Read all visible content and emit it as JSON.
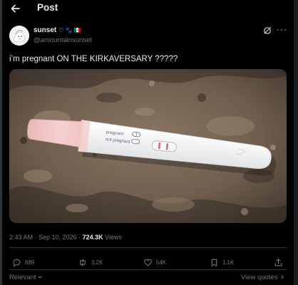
{
  "header": {
    "title": "Post",
    "back_icon": "arrow-left-icon"
  },
  "author": {
    "display_name": "sunset",
    "name_emojis": "♡ 🐾 🇲🇽",
    "handle": "@amountainsunset",
    "avatar_icon": "avatar-image"
  },
  "post": {
    "text": "i’m pregnant ON THE KIRKAVERSARY ?????",
    "media_labels": {
      "pregnant": "pregnant",
      "not_pregnant": "not pregnant"
    }
  },
  "meta": {
    "time": "2:43 AM",
    "separator": " · ",
    "date": "Sep 10, 2026",
    "views_count": "724.3K",
    "views_label": "Views"
  },
  "actions": {
    "replies": "889",
    "reposts": "3.2K",
    "likes": "54K",
    "bookmarks": "1.1K"
  },
  "footer": {
    "sort_label": "Relevant",
    "view_quotes": "View quotes"
  },
  "colors": {
    "background": "#000000",
    "text": "#e7e9ea",
    "muted": "#71767b",
    "divider": "#2f3336"
  }
}
